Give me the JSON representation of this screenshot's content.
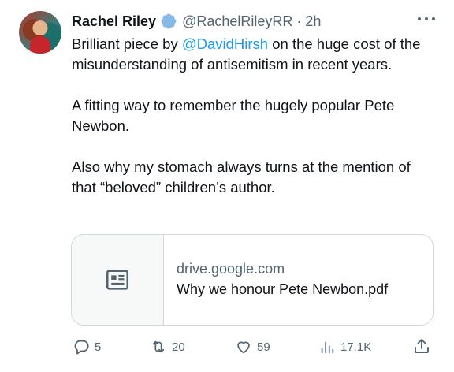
{
  "author": {
    "name": "Rachel Riley",
    "handle": "@RachelRileyRR",
    "separator": "·",
    "time": "2h"
  },
  "tweet": {
    "line1_before": "Brilliant piece by ",
    "mention": "@DavidHirsh",
    "line1_after": " on the huge cost of the misunderstanding of antisemitism in recent years.",
    "paragraph2": "A fitting way to remember the hugely popular Pete Newbon.",
    "paragraph3": "Also why my stomach always turns at the mention of that “beloved” children’s author."
  },
  "card": {
    "domain": "drive.google.com",
    "title": "Why we honour Pete Newbon.pdf",
    "icon": "document-icon"
  },
  "actions": {
    "replies": "5",
    "reposts": "20",
    "likes": "59",
    "views": "17.1K"
  },
  "colors": {
    "accent": "#1d9bf0",
    "verified": "#86b9e6",
    "muted": "#536471",
    "text": "#0f1419",
    "border": "#cfd9de"
  }
}
